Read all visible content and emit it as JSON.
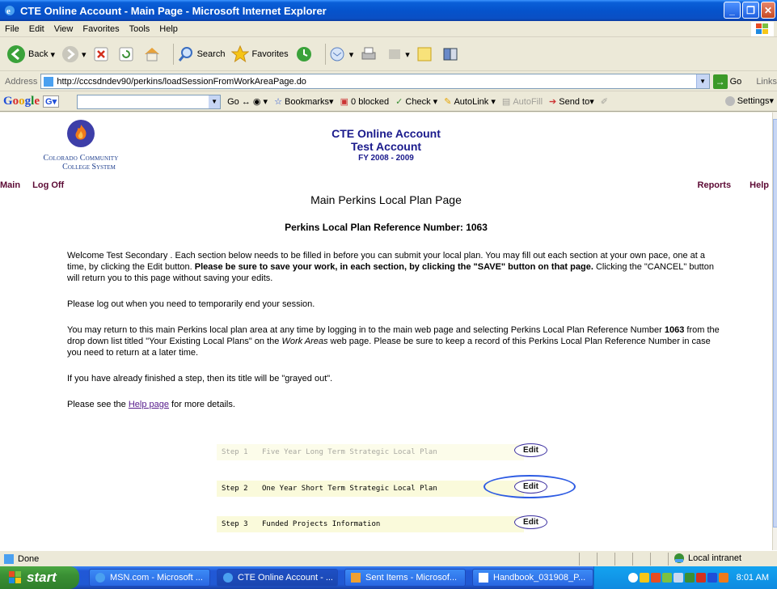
{
  "window": {
    "title": "CTE Online Account - Main Page - Microsoft Internet Explorer"
  },
  "menu": [
    "File",
    "Edit",
    "View",
    "Favorites",
    "Tools",
    "Help"
  ],
  "toolbar": {
    "back": "Back",
    "search": "Search",
    "favorites": "Favorites"
  },
  "address": {
    "label": "Address",
    "url": "http://cccsdndev90/perkins/loadSessionFromWorkAreaPage.do",
    "go": "Go",
    "links": "Links"
  },
  "google": {
    "go": "Go",
    "bookmarks": "Bookmarks",
    "blocked": "0 blocked",
    "check": "Check",
    "autolink": "AutoLink",
    "autofill": "AutoFill",
    "sendto": "Send to",
    "settings": "Settings"
  },
  "logo": {
    "line1": "Colorado Community",
    "line2": "College System"
  },
  "header": {
    "line1": "CTE Online Account",
    "line2": "Test Account",
    "line3": "FY 2008 - 2009"
  },
  "nav": {
    "main": "Main",
    "logoff": "Log Off",
    "reports": "Reports",
    "help": "Help"
  },
  "page": {
    "title": "Main Perkins Local Plan Page",
    "ref": "Perkins Local Plan Reference Number: 1063",
    "p1a": "Welcome Test Secondary . Each section below needs to be filled in before you can submit your local plan. You may fill out each section at your own pace, one at a time, by clicking the Edit button. ",
    "p1b": "Please be sure to save your work, in each section, by clicking the \"SAVE\" button on that page.",
    "p1c": " Clicking the \"CANCEL\" button will return you to this page without saving your edits.",
    "p2": "Please log out when you need to temporarily end your session.",
    "p3a": "You may return to this main Perkins local plan area at any time by logging in to the main web page and selecting Perkins Local Plan Reference Number ",
    "p3b": "1063",
    "p3c": " from the drop down list titled \"Your Existing Local Plans\" on the ",
    "p3d": "Work Areas",
    "p3e": " web page. Please be sure to keep a record of this Perkins Local Plan Reference Number in case you need to return at a later time.",
    "p4": "If you have already finished a step, then its title will be \"grayed out\".",
    "p5a": "Please see the ",
    "p5link": "Help page",
    "p5b": " for more details."
  },
  "steps": [
    {
      "num": "Step 1",
      "label": "Five Year Long Term Strategic Local Plan",
      "edit": "Edit"
    },
    {
      "num": "Step 2",
      "label": "One Year Short Term Strategic Local Plan",
      "edit": "Edit"
    },
    {
      "num": "Step 3",
      "label": "Funded Projects Information",
      "edit": "Edit"
    }
  ],
  "status": {
    "text": "Done",
    "zone": "Local intranet"
  },
  "taskbar": {
    "start": "start",
    "tasks": [
      "MSN.com - Microsoft ...",
      "CTE Online Account - ...",
      "Sent Items - Microsof...",
      "Handbook_031908_P..."
    ],
    "clock": "8:01 AM"
  }
}
